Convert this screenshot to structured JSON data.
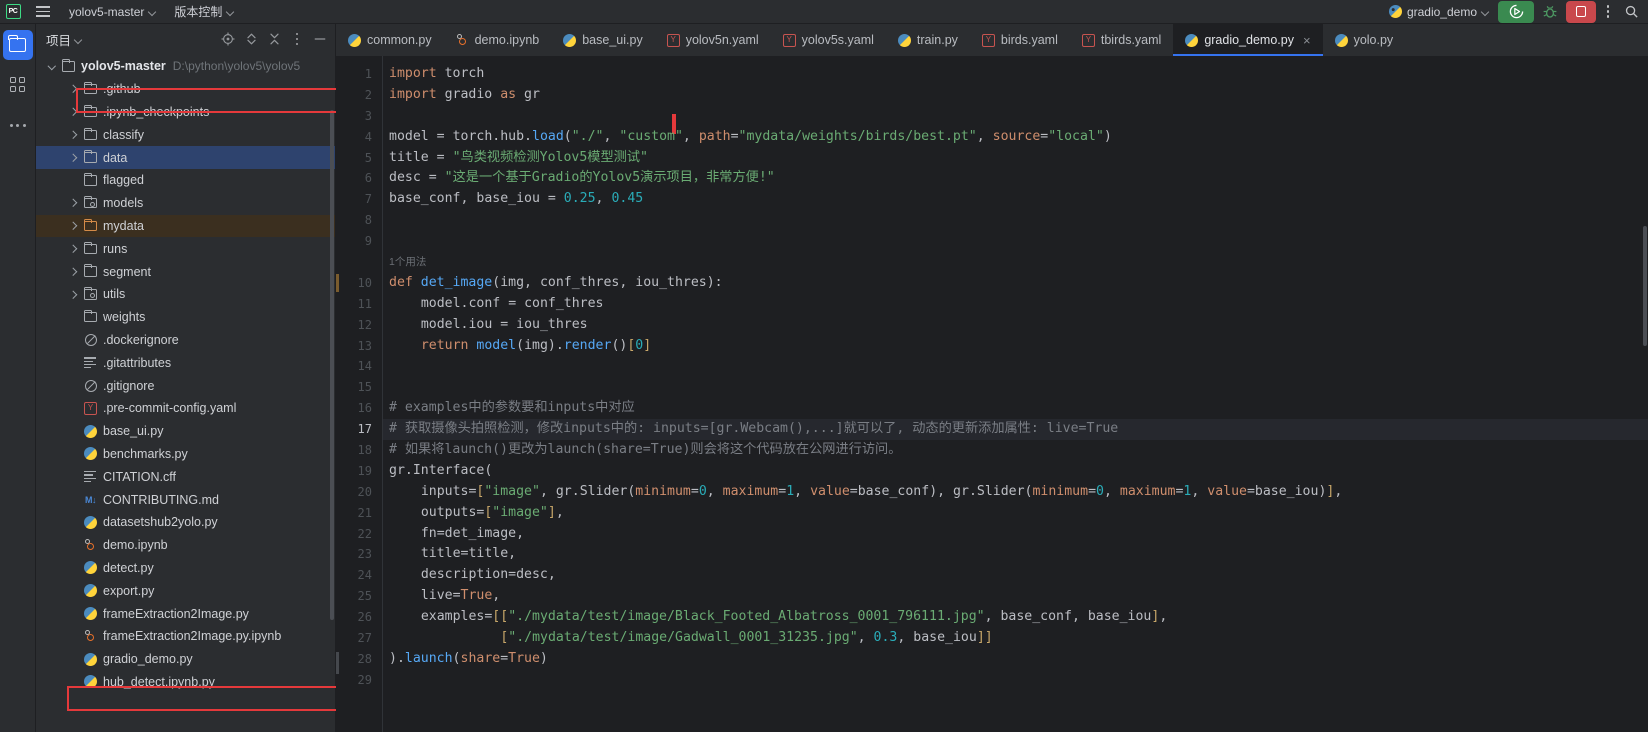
{
  "titlebar": {
    "logo": "pycharm-logo-icon",
    "menu_icon": "hamburger-menu-icon",
    "project_name": "yolov5-master",
    "vcs_label": "版本控制",
    "run_config": "gradio_demo",
    "run_icon": "run-with-coverage-icon",
    "debug_icon": "debug-bug-icon",
    "stop_icon": "stop-square-icon",
    "more_icon": "more-vertical-icon",
    "search_icon": "search-icon"
  },
  "activitybar": {
    "items": [
      {
        "name": "project-folder-icon",
        "label": "Project"
      },
      {
        "name": "structure-squares-icon",
        "label": "Structure"
      },
      {
        "name": "more-horizontal-icon",
        "label": "More"
      }
    ]
  },
  "project_panel": {
    "title": "项目",
    "tools": [
      {
        "name": "select-opened-file-icon",
        "label": "Select Opened File"
      },
      {
        "name": "expand-collapse-icon",
        "label": "Expand All"
      },
      {
        "name": "collapse-all-icon",
        "label": "Collapse All"
      },
      {
        "name": "options-menu-icon",
        "label": "Options"
      },
      {
        "name": "hide-panel-icon",
        "label": "Hide"
      }
    ],
    "tree": [
      {
        "label": "yolov5-master",
        "path": "D:\\python\\yolov5\\yolov5",
        "icon": "folder-icon",
        "arrow": "down",
        "depth": 0,
        "bold": true,
        "highlight": "outlined"
      },
      {
        "label": ".github",
        "icon": "folder-icon",
        "arrow": "right",
        "depth": 1
      },
      {
        "label": ".ipynb_checkpoints",
        "icon": "folder-icon",
        "arrow": "right",
        "depth": 1
      },
      {
        "label": "classify",
        "icon": "folder-icon",
        "arrow": "right",
        "depth": 1
      },
      {
        "label": "data",
        "icon": "folder-icon",
        "arrow": "right",
        "depth": 1,
        "highlight": "selected"
      },
      {
        "label": "flagged",
        "icon": "folder-icon",
        "arrow": "none",
        "depth": 1
      },
      {
        "label": "models",
        "icon": "folder-module-icon",
        "arrow": "right",
        "depth": 1
      },
      {
        "label": "mydata",
        "icon": "folder-orange-icon",
        "arrow": "right",
        "depth": 1,
        "highlight": "mydata"
      },
      {
        "label": "runs",
        "icon": "folder-icon",
        "arrow": "right",
        "depth": 1
      },
      {
        "label": "segment",
        "icon": "folder-icon",
        "arrow": "right",
        "depth": 1
      },
      {
        "label": "utils",
        "icon": "folder-module-icon",
        "arrow": "right",
        "depth": 1
      },
      {
        "label": "weights",
        "icon": "folder-icon",
        "arrow": "none",
        "depth": 1
      },
      {
        "label": ".dockerignore",
        "icon": "ignore-file-icon",
        "arrow": "none",
        "depth": 1
      },
      {
        "label": ".gitattributes",
        "icon": "text-file-icon",
        "arrow": "none",
        "depth": 1
      },
      {
        "label": ".gitignore",
        "icon": "ignore-file-icon",
        "arrow": "none",
        "depth": 1
      },
      {
        "label": ".pre-commit-config.yaml",
        "icon": "yaml-file-icon",
        "arrow": "none",
        "depth": 1
      },
      {
        "label": "base_ui.py",
        "icon": "python-file-icon",
        "arrow": "none",
        "depth": 1
      },
      {
        "label": "benchmarks.py",
        "icon": "python-file-icon",
        "arrow": "none",
        "depth": 1
      },
      {
        "label": "CITATION.cff",
        "icon": "text-file-icon",
        "arrow": "none",
        "depth": 1
      },
      {
        "label": "CONTRIBUTING.md",
        "icon": "markdown-file-icon",
        "arrow": "none",
        "depth": 1
      },
      {
        "label": "datasetshub2yolo.py",
        "icon": "python-file-icon",
        "arrow": "none",
        "depth": 1
      },
      {
        "label": "demo.ipynb",
        "icon": "notebook-file-icon",
        "arrow": "none",
        "depth": 1
      },
      {
        "label": "detect.py",
        "icon": "python-file-icon",
        "arrow": "none",
        "depth": 1
      },
      {
        "label": "export.py",
        "icon": "python-file-icon",
        "arrow": "none",
        "depth": 1
      },
      {
        "label": "frameExtraction2Image.py",
        "icon": "python-file-icon",
        "arrow": "none",
        "depth": 1
      },
      {
        "label": "frameExtraction2Image.py.ipynb",
        "icon": "notebook-file-icon",
        "arrow": "none",
        "depth": 1
      },
      {
        "label": "gradio_demo.py",
        "icon": "python-file-icon",
        "arrow": "none",
        "depth": 1,
        "highlight": "outlined"
      },
      {
        "label": "hub_detect.ipynb.py",
        "icon": "python-file-icon",
        "arrow": "none",
        "depth": 1
      }
    ]
  },
  "tabs": [
    {
      "label": "common.py",
      "icon": "python-file-icon",
      "active": false
    },
    {
      "label": "demo.ipynb",
      "icon": "notebook-file-icon",
      "active": false
    },
    {
      "label": "base_ui.py",
      "icon": "python-file-icon",
      "active": false
    },
    {
      "label": "yolov5n.yaml",
      "icon": "yaml-file-icon",
      "active": false
    },
    {
      "label": "yolov5s.yaml",
      "icon": "yaml-file-icon",
      "active": false
    },
    {
      "label": "train.py",
      "icon": "python-file-icon",
      "active": false
    },
    {
      "label": "birds.yaml",
      "icon": "yaml-file-icon",
      "active": false
    },
    {
      "label": "tbirds.yaml",
      "icon": "yaml-file-icon",
      "active": false
    },
    {
      "label": "gradio_demo.py",
      "icon": "python-file-icon",
      "active": true,
      "close": "×"
    },
    {
      "label": "yolo.py",
      "icon": "python-file-icon",
      "active": false
    }
  ],
  "editor": {
    "usage_hint": "1个用法",
    "line_numbers": [
      "1",
      "2",
      "3",
      "4",
      "5",
      "6",
      "7",
      "8",
      "9",
      "10",
      "11",
      "12",
      "13",
      "14",
      "15",
      "16",
      "17",
      "18",
      "19",
      "20",
      "21",
      "22",
      "23",
      "24",
      "25",
      "26",
      "27",
      "28",
      "29"
    ],
    "current_line": 17,
    "code": [
      "import torch",
      "import gradio as gr",
      "",
      "model = torch.hub.load(\"./\", \"custom\", path=\"mydata/weights/birds/best.pt\", source=\"local\")",
      "title = \"鸟类视频检测Yolov5模型测试\"",
      "desc = \"这是一个基于Gradio的Yolov5演示项目，非常方便!\"",
      "base_conf, base_iou = 0.25, 0.45",
      "",
      "",
      "def det_image(img, conf_thres, iou_thres):",
      "    model.conf = conf_thres",
      "    model.iou = iou_thres",
      "    return model(img).render()[0]",
      "",
      "",
      "# examples中的参数要和inputs中对应",
      "# 获取摄像头拍照检测，修改inputs中的: inputs=[gr.Webcam(),...]就可以了, 动态的更新添加属性: live=True",
      "# 如果将launch()更改为launch(share=True)则会将这个代码放在公网进行访问。",
      "gr.Interface(",
      "    inputs=[\"image\", gr.Slider(minimum=0, maximum=1, value=base_conf), gr.Slider(minimum=0, maximum=1, value=base_iou)],",
      "    outputs=[\"image\"],",
      "    fn=det_image,",
      "    title=title,",
      "    description=desc,",
      "    live=True,",
      "    examples=[[\"./mydata/test/image/Black_Footed_Albatross_0001_796111.jpg\", base_conf, base_iou],",
      "              [\"./mydata/test/image/Gadwall_0001_31235.jpg\", 0.3, base_iou]]",
      ").launch(share=True)",
      ""
    ]
  },
  "colors": {
    "background": "#1e1f22",
    "panel": "#2b2d30",
    "accent_blue": "#3573f0",
    "run_green": "#3a8a50",
    "stop_red": "#c9484c",
    "highlight_red": "#e5393b",
    "string_green": "#6aab73",
    "keyword_orange": "#cf8e6d",
    "number_cyan": "#2aacb8",
    "comment_gray": "#7a7e85",
    "function_blue": "#56a8f5",
    "selection_blue": "#2e436e",
    "mydata_brown": "#3b2f1f"
  }
}
